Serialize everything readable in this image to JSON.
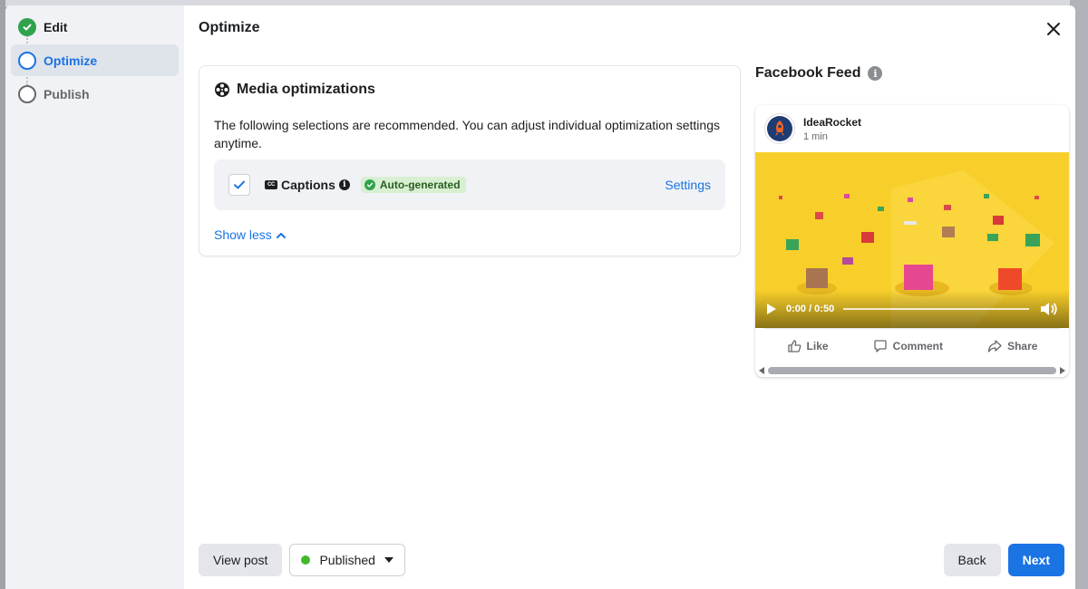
{
  "sidebar": {
    "steps": [
      {
        "label": "Edit",
        "state": "done"
      },
      {
        "label": "Optimize",
        "state": "active"
      },
      {
        "label": "Publish",
        "state": "pending"
      }
    ]
  },
  "header": {
    "title": "Optimize",
    "close_icon": "close-icon"
  },
  "media_card": {
    "title": "Media optimizations",
    "icon": "film-reel-icon",
    "description": "The following selections are recommended. You can adjust individual optimization settings anytime.",
    "option": {
      "checked": true,
      "cc_glyph": "CC",
      "label": "Captions",
      "info_glyph": "i",
      "badge": "Auto-generated",
      "settings_label": "Settings"
    },
    "show_less_label": "Show less"
  },
  "preview": {
    "title": "Facebook Feed",
    "info_glyph": "i",
    "post": {
      "page_name": "IdeaRocket",
      "time": "1 min",
      "video": {
        "timecode": "0:00 / 0:50"
      },
      "actions": {
        "like": "Like",
        "comment": "Comment",
        "share": "Share"
      }
    }
  },
  "footer": {
    "view_post_label": "View post",
    "status_label": "Published",
    "back_label": "Back",
    "next_label": "Next"
  },
  "colors": {
    "accent": "#1b74e4",
    "success": "#31a24c",
    "published_dot": "#42b72a",
    "video_bg": "#f8cf2a"
  }
}
